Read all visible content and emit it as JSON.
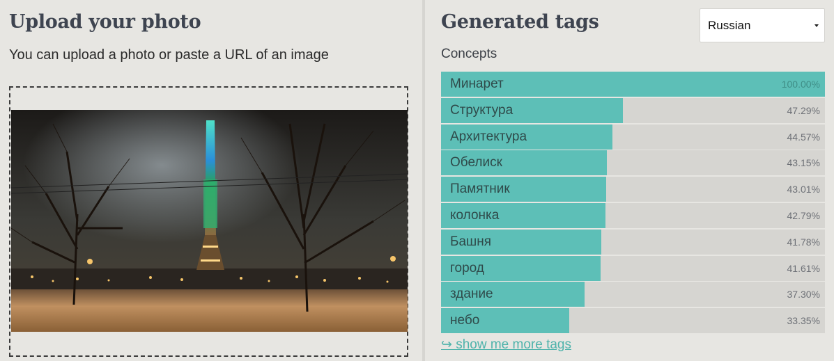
{
  "upload": {
    "title": "Upload your photo",
    "subtitle": "You can upload a photo or paste a URL of an image"
  },
  "results": {
    "title": "Generated tags",
    "language": "Russian",
    "section_label": "Concepts",
    "more_link": "↪ show me more tags",
    "tags": [
      {
        "name": "Минарет",
        "percent": "100.00%",
        "value": 1.0
      },
      {
        "name": "Структура",
        "percent": "47.29%",
        "value": 0.4729
      },
      {
        "name": "Архитектура",
        "percent": "44.57%",
        "value": 0.4457
      },
      {
        "name": "Обелиск",
        "percent": "43.15%",
        "value": 0.4315
      },
      {
        "name": "Памятник",
        "percent": "43.01%",
        "value": 0.4301
      },
      {
        "name": "колонка",
        "percent": "42.79%",
        "value": 0.4279
      },
      {
        "name": "Башня",
        "percent": "41.78%",
        "value": 0.4178
      },
      {
        "name": "город",
        "percent": "41.61%",
        "value": 0.4161
      },
      {
        "name": "здание",
        "percent": "37.30%",
        "value": 0.373
      },
      {
        "name": "небо",
        "percent": "33.35%",
        "value": 0.3335
      }
    ]
  },
  "colors": {
    "accent": "#5dbfb7",
    "track": "#d6d5d1",
    "background": "#e7e6e2",
    "heading": "#3e4450"
  }
}
